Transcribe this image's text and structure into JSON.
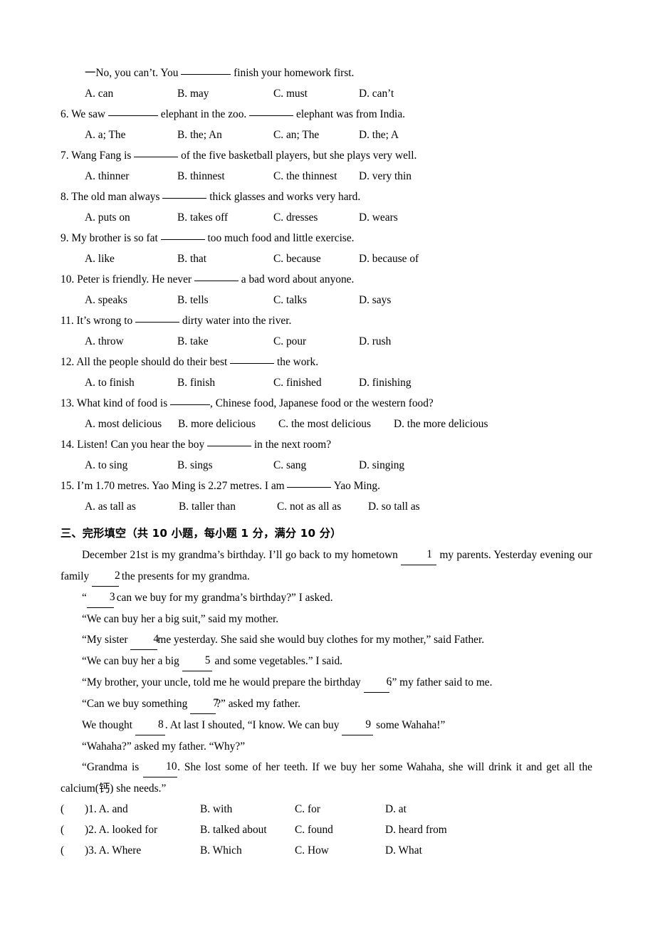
{
  "document": {
    "title": "English exam paper page",
    "language": "en-zh"
  },
  "multiple_choice": {
    "continued_stem": {
      "text": "一No, you can’t. You",
      "after": "finish your homework first."
    },
    "questions": [
      {
        "number": "",
        "stem_before": "一No, you can’t. You",
        "stem_after": "finish your homework first.",
        "options": [
          "A. can",
          "B. may",
          "C. must",
          "D. can’t"
        ]
      },
      {
        "number": "6.",
        "stem_before": "6. We saw",
        "stem_mid": "elephant in the zoo.",
        "stem_after": "elephant was from India.",
        "options": [
          "A. a; The",
          "B. the; An",
          "C. an; The",
          "D. the; A"
        ]
      },
      {
        "number": "7.",
        "stem_before": "7. Wang Fang is",
        "stem_after": "of the five basketball players, but she plays very well.",
        "options": [
          "A. thinner",
          "B. thinnest",
          "C. the thinnest",
          "D. very thin"
        ]
      },
      {
        "number": "8.",
        "stem_before": "8. The old man always",
        "stem_after": "thick glasses and works very hard.",
        "options": [
          "A. puts on",
          "B. takes off",
          "C. dresses",
          "D. wears"
        ]
      },
      {
        "number": "9.",
        "stem_before": "9. My brother is so fat",
        "stem_after": "too much food and little exercise.",
        "options": [
          "A. like",
          "B. that",
          "C. because",
          "D. because of"
        ]
      },
      {
        "number": "10.",
        "stem_before": "10. Peter is friendly. He never",
        "stem_after": "a bad word about anyone.",
        "options": [
          "A. speaks",
          "B. tells",
          "C. talks",
          "D. says"
        ]
      },
      {
        "number": "11.",
        "stem_before": "11. It’s wrong to",
        "stem_after": "dirty water into the river.",
        "options": [
          "A. throw",
          "B. take",
          "C. pour",
          "D. rush"
        ]
      },
      {
        "number": "12.",
        "stem_before": "12. All the people should do their best",
        "stem_after": "the work.",
        "options": [
          "A. to finish",
          "B. finish",
          "C. finished",
          "D. finishing"
        ]
      },
      {
        "number": "13.",
        "stem_before": "13. What kind of food is",
        "stem_after": ", Chinese food, Japanese food or the western food?",
        "options": [
          "A. most delicious",
          "B. more delicious",
          "C. the most delicious",
          "D. the more delicious"
        ]
      },
      {
        "number": "14.",
        "stem_before": "14. Listen! Can you hear the boy",
        "stem_after": "in the next room?",
        "options": [
          "A. to sing",
          "B. sings",
          "C. sang",
          "D. singing"
        ]
      },
      {
        "number": "15.",
        "stem_before": "15. I’m 1.70 metres. Yao Ming is 2.27 metres. I am",
        "stem_after": "Yao Ming.",
        "options": [
          "A. as tall as",
          "B. taller than",
          "C. not as all as",
          "D. so tall as"
        ]
      }
    ]
  },
  "cloze_section": {
    "heading": "三、完形填空（共 10 小题，每小题 1 分，满分 10 分）",
    "passage": {
      "p1_a": "December 21st is my grandma’s birthday. I’ll go back to my hometown",
      "b1": "1",
      "p1_b": "my parents. Yesterday evening our family",
      "b2": "2",
      "p1_c": "the presents for my grandma.",
      "p2_a": "“",
      "b3": "3",
      "p2_b": "can we buy for my grandma’s birthday?” I asked.",
      "p3": "“We can buy her a big suit,” said my mother.",
      "p4_a": "“My sister",
      "b4": "4",
      "p4_b": "me yesterday. She said she would buy clothes for my mother,” said Father.",
      "p5_a": "“We can buy her a big",
      "b5": "5",
      "p5_b": "and some vegetables.” I said.",
      "p6_a": "“My brother, your uncle, told me he would prepare the birthday",
      "b6": "6",
      "p6_b": ".” my father said to me.",
      "p7_a": "“Can we buy something",
      "b7": "7",
      "p7_b": "?” asked my father.",
      "p8_a": "We thought",
      "b8": "8",
      "p8_b": ". At last I shouted, “I know. We can buy",
      "b9": "9",
      "p8_c": "some Wahaha!”",
      "p9": "“Wahaha?” asked my father. “Why?”",
      "p10_a": "“Grandma is",
      "b10": "10",
      "p10_b": ". She lost some of her teeth. If we buy her some Wahaha, she will drink it and get all the calcium(钙) she needs.”"
    },
    "answer_rows": [
      {
        "paren": "(",
        "label": ")1. A. and",
        "options": [
          "B. with",
          "C. for",
          "D. at"
        ]
      },
      {
        "paren": "(",
        "label": ")2. A. looked for",
        "options": [
          "B. talked about",
          "C. found",
          "D. heard from"
        ]
      },
      {
        "paren": "(",
        "label": ")3. A. Where",
        "options": [
          "B. Which",
          "C. How",
          "D. What"
        ]
      }
    ]
  }
}
